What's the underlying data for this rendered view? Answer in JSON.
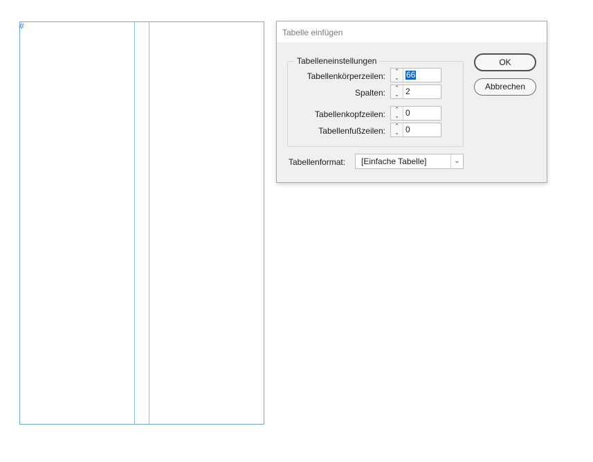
{
  "canvas": {
    "frame_marker": "#"
  },
  "dialog": {
    "title": "Tabelle einfügen",
    "group": {
      "legend": "Tabelleneinstellungen",
      "fields": [
        {
          "label": "Tabellenkörperzeilen:",
          "value": "66",
          "selected": true
        },
        {
          "label": "Spalten:",
          "value": "2"
        },
        {
          "label": "Tabellenkopfzeilen:",
          "value": "0"
        },
        {
          "label": "Tabellenfußzeilen:",
          "value": "0"
        }
      ]
    },
    "format": {
      "label": "Tabellenformat:",
      "value": "[Einfache Tabelle]"
    },
    "buttons": {
      "ok": "OK",
      "cancel": "Abbrechen"
    },
    "icons": {
      "spin_up": "chevron-up-icon",
      "spin_down": "chevron-down-icon",
      "dropdown": "chevron-down-icon"
    },
    "colors": {
      "selection": "#0a64d1",
      "frame": "#6fa8d6"
    }
  }
}
